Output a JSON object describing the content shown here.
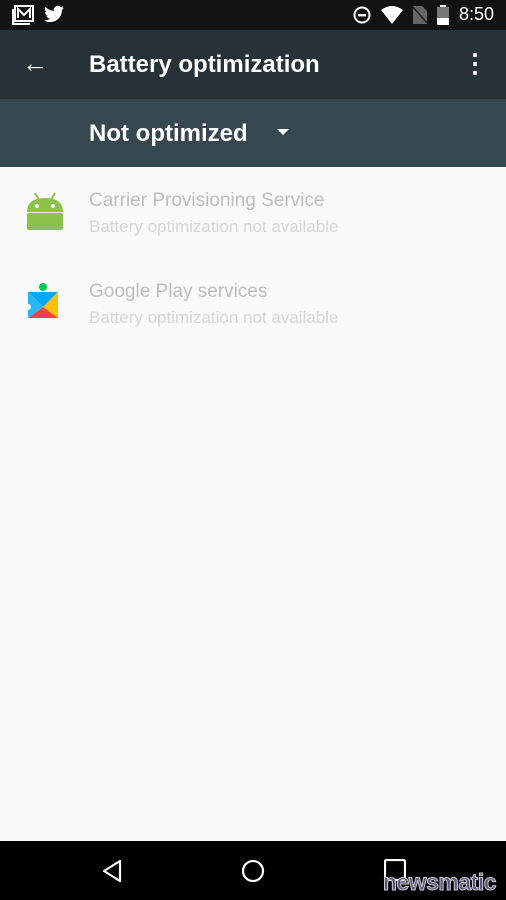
{
  "status_bar": {
    "time": "8:50",
    "battery_level": "35",
    "icons": [
      "gmail-icon",
      "twitter-icon",
      "dnd-icon",
      "wifi-icon",
      "no-sim-icon",
      "battery-icon"
    ]
  },
  "toolbar": {
    "title": "Battery optimization",
    "back_icon": "arrow-back-icon",
    "menu_icon": "more-vert-icon"
  },
  "filter": {
    "selected": "Not optimized"
  },
  "apps": [
    {
      "name": "Carrier Provisioning Service",
      "status": "Battery optimization not available",
      "icon": "android-icon"
    },
    {
      "name": "Google Play services",
      "status": "Battery optimization not available",
      "icon": "play-services-icon"
    }
  ],
  "nav_bar": {
    "icons": [
      "back-icon",
      "home-icon",
      "recents-icon"
    ]
  },
  "watermark": "newsmatic"
}
